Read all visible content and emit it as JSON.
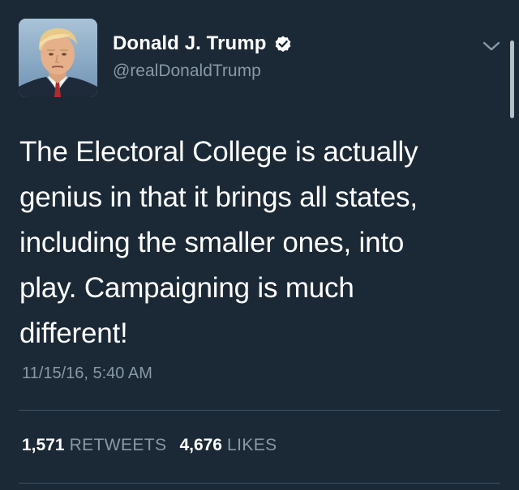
{
  "user": {
    "display_name": "Donald J. Trump",
    "handle": "@realDonaldTrump",
    "verified": true
  },
  "tweet": {
    "lines": [
      "The Electoral College is actually",
      "genius in that it brings all states,",
      "including the smaller ones, into",
      "play. Campaigning is much",
      "different!"
    ],
    "timestamp": "11/15/16, 5:40 AM"
  },
  "stats": {
    "retweets_count": "1,571",
    "retweets_label": "RETWEETS",
    "likes_count": "4,676",
    "likes_label": "LIKES"
  },
  "icons": {
    "verified": "verified-badge-icon",
    "menu": "chevron-down-icon"
  },
  "colors": {
    "background": "#1b2836",
    "text": "#ffffff",
    "secondary_text": "#8899a6",
    "divider": "#3d5466"
  }
}
